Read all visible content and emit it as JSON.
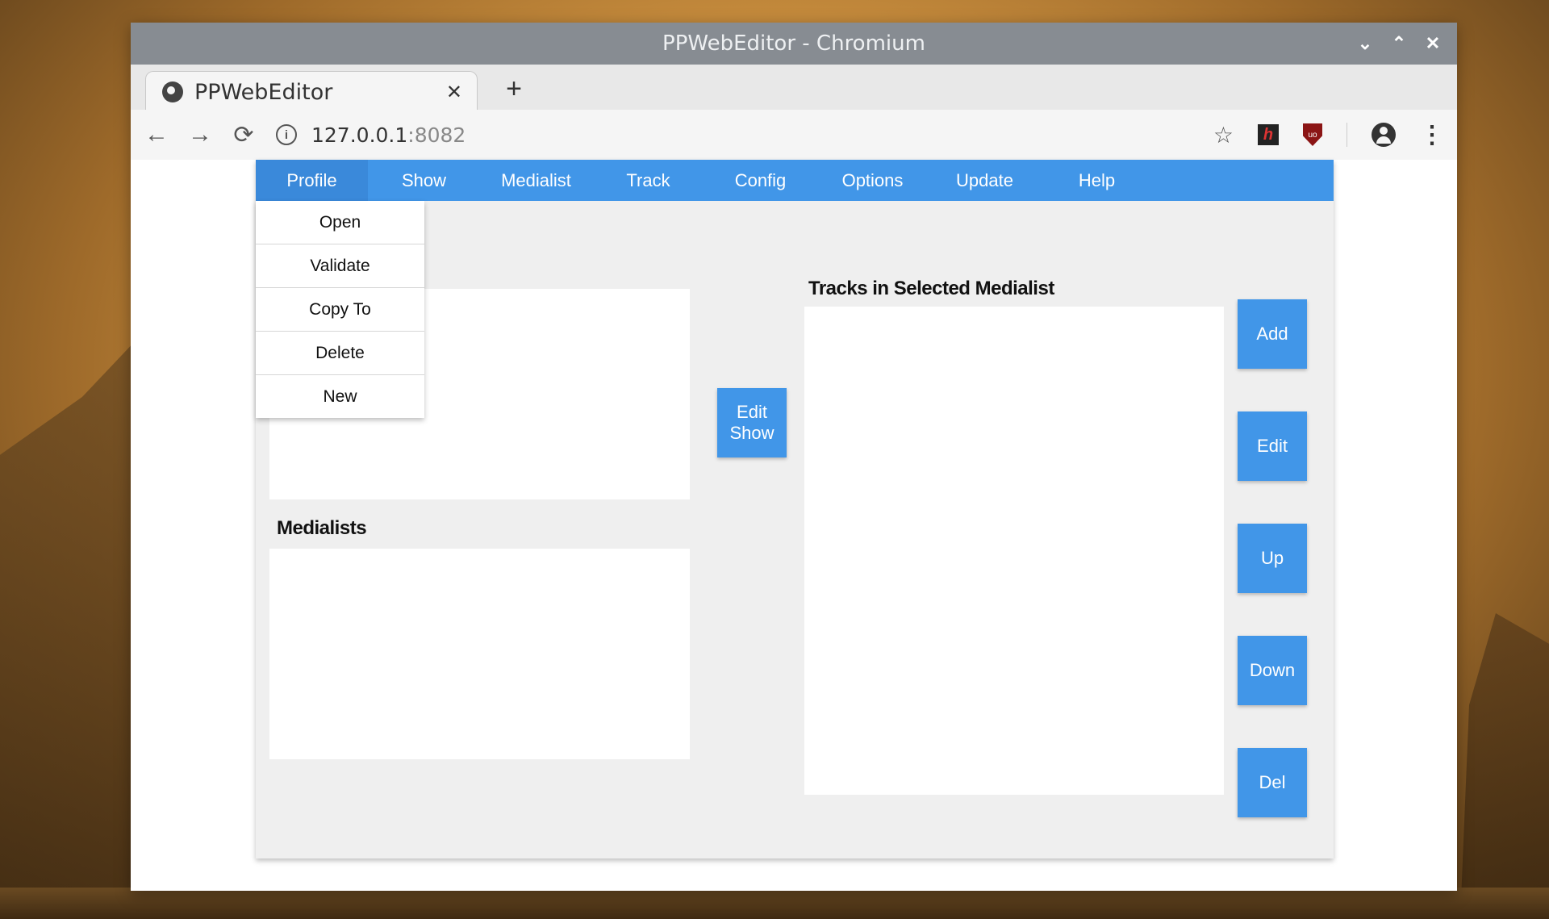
{
  "window": {
    "title": "PPWebEditor - Chromium",
    "controls": [
      "⌄",
      "⌃",
      "✕"
    ]
  },
  "tab": {
    "title": "PPWebEditor",
    "close": "✕",
    "new_tab": "+"
  },
  "toolbar": {
    "back": "←",
    "forward": "→",
    "reload": "⟳",
    "url_host": "127.0.0.1",
    "url_port": ":8082",
    "info": "i",
    "bookmark": "☆",
    "ext_h": "h",
    "ext_ub": "uo",
    "menu": "⋮"
  },
  "menubar": {
    "items": [
      "Profile",
      "Show",
      "Medialist",
      "Track",
      "Config",
      "Options",
      "Update",
      "Help"
    ]
  },
  "profile_menu": {
    "items": [
      "Open",
      "Validate",
      "Copy To",
      "Delete",
      "New"
    ]
  },
  "main": {
    "medialists_heading": "Medialists",
    "tracks_heading": "Tracks in Selected Medialist",
    "edit_show_line1": "Edit",
    "edit_show_line2": "Show"
  },
  "track_buttons": [
    "Add",
    "Edit",
    "Up",
    "Down",
    "Del"
  ],
  "colors": {
    "accent": "#4196e8",
    "panel": "#efefef",
    "titlebar": "#878c92"
  }
}
